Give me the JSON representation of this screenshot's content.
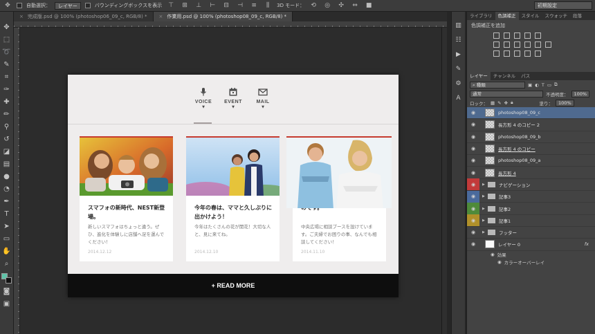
{
  "options_bar": {
    "auto_select_label": "自動選択：",
    "auto_select_value": "レイヤー",
    "transform_label": "バウンディングボックスを表示",
    "mode_3d_label": "3D モード：",
    "workspace_value": "初期設定"
  },
  "tabs": [
    {
      "label": "完成版.psd @ 100% (photoshop06_09_c, RGB/8) *",
      "active": false
    },
    {
      "label": "作業用.psd @ 100% (photoshop08_09_c, RGB/8) *",
      "active": true
    }
  ],
  "mockup": {
    "nav": [
      {
        "icon": "microphone-icon",
        "label": "VOICE"
      },
      {
        "icon": "calendar-icon",
        "label": "EVENT"
      },
      {
        "icon": "mail-icon",
        "label": "MAIL"
      }
    ],
    "cards": [
      {
        "title": "スマフォの新時代、NEST新登場。",
        "body": "新しいスマフォはちょっと違う。ぜひ、進化を体験しに店舗へ足を運んでください！",
        "date": "2014.12.12"
      },
      {
        "title": "今年の春は、ママと久しぶりに出かけよう！",
        "body": "今年はたくさんの花が開花！大切な人と、見に来てね。",
        "date": "2014.12.10"
      },
      {
        "title": "のです。",
        "body": "中央広場に相談ブースを設けています。ご夫婦でお困りの事、なんでも相談してください！",
        "date": "2014.11.10"
      }
    ],
    "read_more": "+ READ MORE"
  },
  "right_panel": {
    "top_tabs": [
      "ライブラリ",
      "色調補正",
      "スタイル",
      "スウォッチ",
      "段落"
    ],
    "active_top_tab": "色調補正",
    "adjust_title": "色調補正を追加",
    "layer_tabs": [
      "レイヤー",
      "チャンネル",
      "パス"
    ],
    "filter_kind": "種類",
    "blend_mode": "通常",
    "opacity_label": "不透明度：",
    "opacity_value": "100%",
    "lock_label": "ロック：",
    "fill_label": "塗り：",
    "fill_value": "100%",
    "layers": [
      {
        "name": "photoshop08_09_c",
        "type": "smart",
        "selected": true,
        "underline": false
      },
      {
        "name": "長方形 4 のコピー 2",
        "type": "shape",
        "selected": false,
        "underline": false
      },
      {
        "name": "photoshop08_09_b",
        "type": "smart",
        "selected": false,
        "underline": false
      },
      {
        "name": "長方形 4 のコピー",
        "type": "shape",
        "selected": false,
        "underline": true
      },
      {
        "name": "photoshop08_09_a",
        "type": "smart",
        "selected": false,
        "underline": false
      },
      {
        "name": "長方形 4",
        "type": "shape",
        "selected": false,
        "underline": true
      },
      {
        "name": "ナビゲーション",
        "type": "group",
        "color": "#c23a3a",
        "selected": false,
        "underline": false
      },
      {
        "name": "記事3",
        "type": "group",
        "color": "#4a6a9c",
        "selected": false,
        "underline": false
      },
      {
        "name": "記事2",
        "type": "group",
        "color": "#4e8a3a",
        "selected": false,
        "underline": false
      },
      {
        "name": "記事1",
        "type": "group",
        "color": "#b0902a",
        "selected": false,
        "underline": false
      },
      {
        "name": "フッター",
        "type": "group",
        "selected": false,
        "underline": false
      },
      {
        "name": "レイヤー 0",
        "type": "pixel",
        "selected": false,
        "underline": false,
        "fx": "fx"
      }
    ],
    "effects_label": "効果",
    "effect_item": "カラーオーバーレイ"
  }
}
